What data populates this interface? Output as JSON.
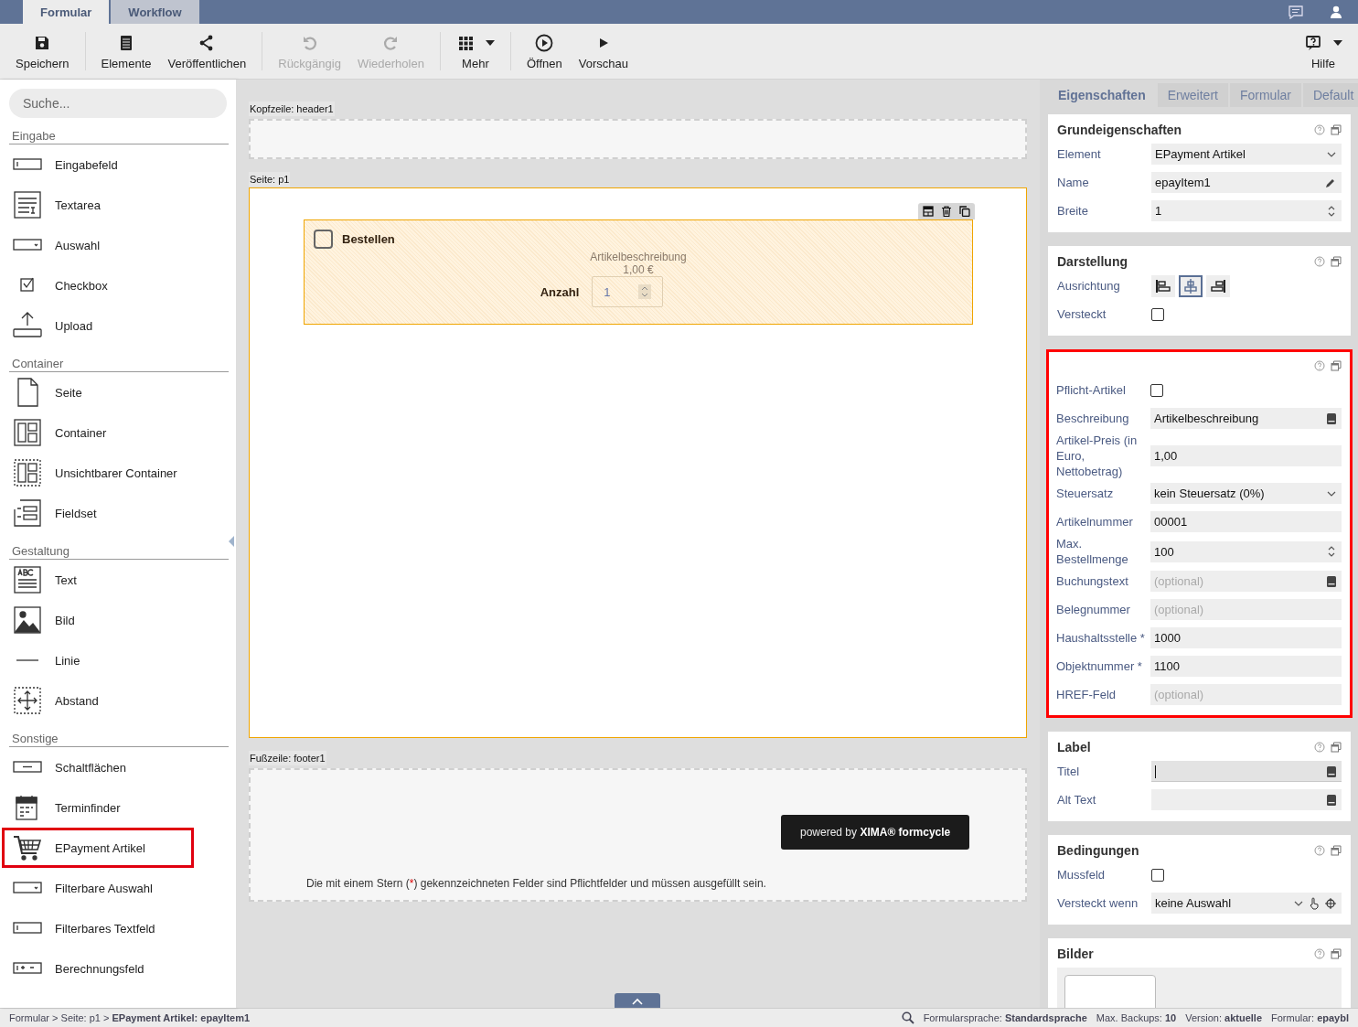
{
  "top_tabs": [
    {
      "label": "Formular",
      "selected": true
    },
    {
      "label": "Workflow",
      "selected": false
    }
  ],
  "toolbar": {
    "groups": [
      [
        {
          "label": "Speichern",
          "disabled": false
        }
      ],
      [
        {
          "label": "Elemente",
          "disabled": false
        },
        {
          "label": "Veröffentlichen",
          "disabled": false
        }
      ],
      [
        {
          "label": "Rückgängig",
          "disabled": true
        },
        {
          "label": "Wiederholen",
          "disabled": true
        }
      ],
      [
        {
          "label": "Mehr",
          "disabled": false
        }
      ],
      [
        {
          "label": "Öffnen",
          "disabled": false
        },
        {
          "label": "Vorschau",
          "disabled": false
        }
      ]
    ],
    "help": {
      "label": "Hilfe"
    }
  },
  "sidebar": {
    "search": {
      "placeholder": "Suche..."
    },
    "sections": [
      {
        "title": "Eingabe",
        "items": [
          {
            "label": "Eingabefeld",
            "highlighted": false
          },
          {
            "label": "Textarea",
            "highlighted": false
          },
          {
            "label": "Auswahl",
            "highlighted": false
          },
          {
            "label": "Checkbox",
            "highlighted": false
          },
          {
            "label": "Upload",
            "highlighted": false
          }
        ]
      },
      {
        "title": "Container",
        "items": [
          {
            "label": "Seite",
            "highlighted": false
          },
          {
            "label": "Container",
            "highlighted": false
          },
          {
            "label": "Unsichtbarer Container",
            "highlighted": false
          },
          {
            "label": "Fieldset",
            "highlighted": false
          }
        ]
      },
      {
        "title": "Gestaltung",
        "items": [
          {
            "label": "Text",
            "highlighted": false
          },
          {
            "label": "Bild",
            "highlighted": false
          },
          {
            "label": "Linie",
            "highlighted": false
          },
          {
            "label": "Abstand",
            "highlighted": false
          }
        ]
      },
      {
        "title": "Sonstige",
        "items": [
          {
            "label": "Schaltflächen",
            "highlighted": false
          },
          {
            "label": "Terminfinder",
            "highlighted": false
          },
          {
            "label": "EPayment Artikel",
            "highlighted": true
          },
          {
            "label": "Filterbare Auswahl",
            "highlighted": false
          },
          {
            "label": "Filterbares Textfeld",
            "highlighted": false
          },
          {
            "label": "Berechnungsfeld",
            "highlighted": false
          }
        ]
      }
    ]
  },
  "canvas": {
    "header_label": "Kopfzeile: header1",
    "page_label": "Seite: p1",
    "element": {
      "checkbox_label": "Bestellen",
      "checked": false,
      "description": "Artikelbeschreibung",
      "price": "1,00 €",
      "quantity_label": "Anzahl",
      "quantity": "1"
    },
    "footer_label": "Fußzeile: footer1",
    "powered_by": "powered by **XIMA® formcycle**",
    "required_note": [
      "Die mit einem Stern (",
      "*",
      ") gekennzeichneten Felder sind Pflichtfelder und müssen ausgefüllt sein."
    ]
  },
  "properties": {
    "tabs": [
      {
        "label": "Eigenschaften",
        "selected": true
      },
      {
        "label": "Erweitert",
        "selected": false
      },
      {
        "label": "Formular",
        "selected": false
      },
      {
        "label": "Default",
        "selected": false
      }
    ],
    "sections": [
      {
        "title": "Grundeigenschaften",
        "highlighted": false,
        "rows": [
          {
            "kind": "select",
            "label": "Element",
            "value": "EPayment Artikel"
          },
          {
            "kind": "editable",
            "label": "Name",
            "value": "epayItem1"
          },
          {
            "kind": "number",
            "label": "Breite",
            "value": "1"
          }
        ]
      },
      {
        "title": "Darstellung",
        "highlighted": false,
        "rows": [
          {
            "kind": "align",
            "label": "Ausrichtung",
            "options": [
              {
                "selected": false
              },
              {
                "selected": true
              },
              {
                "selected": false
              }
            ]
          },
          {
            "kind": "checkbox",
            "label": "Versteckt",
            "checked": false
          }
        ]
      },
      {
        "highlighted": true,
        "rows": [
          {
            "kind": "checkbox",
            "label": "Pflicht-Artikel",
            "checked": false
          },
          {
            "kind": "translatable",
            "label": "Beschreibung",
            "value": "Artikelbeschreibung"
          },
          {
            "kind": "text",
            "label": "Artikel-Preis (in Euro, Nettobetrag)",
            "value": "1,00"
          },
          {
            "kind": "select",
            "label": "Steuersatz",
            "value": "kein Steuersatz (0%)"
          },
          {
            "kind": "text",
            "label": "Artikelnummer",
            "value": "00001"
          },
          {
            "kind": "number",
            "label": "Max. Bestellmenge",
            "value": "100"
          },
          {
            "kind": "translatable",
            "label": "Buchungstext",
            "placeholder": "(optional)"
          },
          {
            "kind": "text",
            "label": "Belegnummer",
            "placeholder": "(optional)"
          },
          {
            "kind": "text",
            "label": "Haushaltsstelle *",
            "value": "1000"
          },
          {
            "kind": "text",
            "label": "Objektnummer *",
            "value": "1100"
          },
          {
            "kind": "text",
            "label": "HREF-Feld",
            "placeholder": "(optional)"
          }
        ]
      },
      {
        "title": "Label",
        "highlighted": false,
        "rows": [
          {
            "kind": "translatable",
            "label": "Titel",
            "focused": true
          },
          {
            "kind": "translatable",
            "label": "Alt Text",
            "focused": false
          }
        ]
      },
      {
        "title": "Bedingungen",
        "highlighted": false,
        "rows": [
          {
            "kind": "checkbox",
            "label": "Mussfeld",
            "checked": false
          },
          {
            "kind": "condition",
            "label": "Versteckt wenn",
            "value": "keine Auswahl"
          }
        ]
      },
      {
        "title": "Bilder",
        "highlighted": false,
        "rows": [
          {
            "kind": "images"
          }
        ]
      }
    ]
  },
  "status_bar": {
    "breadcrumb": "Formular > Seite: p1 > **EPayment Artikel: epayItem1**",
    "items": [
      "Formularsprache: **Standardsprache**",
      "Max. Backups: **10**",
      "Version: **aktuelle**",
      "Formular: **epaybl**"
    ]
  }
}
